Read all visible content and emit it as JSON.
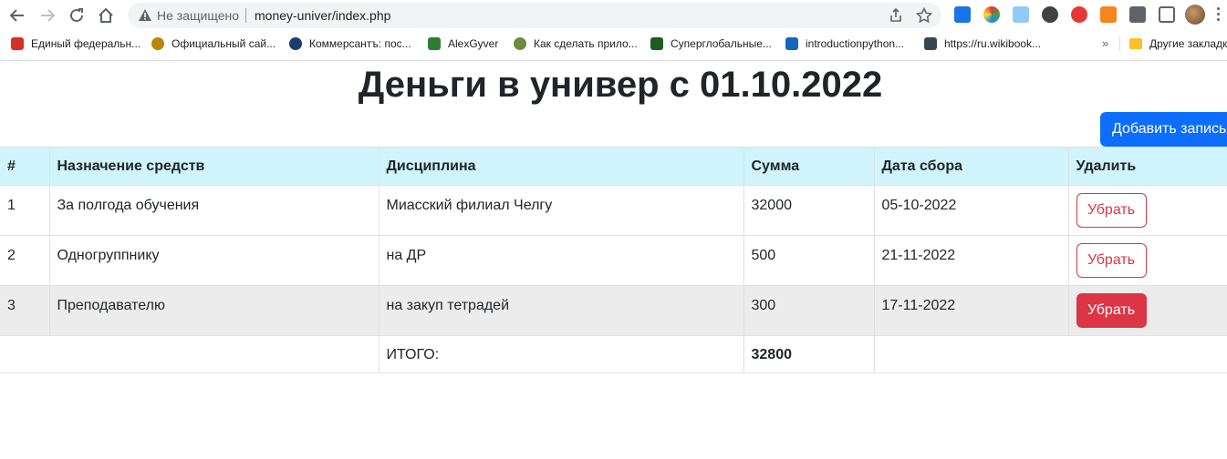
{
  "browser": {
    "security_label": "Не защищено",
    "url": "money-univer/index.php",
    "bookmarks": [
      {
        "label": "Единый федеральн...",
        "color": "#d93025"
      },
      {
        "label": "Официальный сай...",
        "color": "#b8860b"
      },
      {
        "label": "Коммерсантъ: пос...",
        "color": "#1a3d6d"
      },
      {
        "label": "AlexGyver",
        "color": "#2e7d32"
      },
      {
        "label": "Как сделать прило...",
        "color": "#6d8b3a"
      },
      {
        "label": "Суперглобальные...",
        "color": "#1b5e20"
      },
      {
        "label": "introductionpython...",
        "color": "#1565c0"
      },
      {
        "label": "https://ru.wikibook...",
        "color": "#37474f"
      }
    ],
    "more_bookmarks": "»",
    "other_bookmarks": "Другие закладки"
  },
  "page": {
    "title": "Деньги в универ с 01.10.2022",
    "add_button": "Добавить запись"
  },
  "table": {
    "headers": [
      "#",
      "Назначение средств",
      "Дисциплина",
      "Сумма",
      "Дата сбора",
      "Удалить"
    ],
    "rows": [
      {
        "num": "1",
        "purpose": "За полгода обучения",
        "discipline": "Миасский филиал Челгу",
        "sum": "32000",
        "date": "05-10-2022",
        "action": "Убрать"
      },
      {
        "num": "2",
        "purpose": "Одногруппнику",
        "discipline": "на ДР",
        "sum": "500",
        "date": "21-11-2022",
        "action": "Убрать"
      },
      {
        "num": "3",
        "purpose": "Преподавателю",
        "discipline": "на закуп тетрадей",
        "sum": "300",
        "date": "17-11-2022",
        "action": "Убрать"
      }
    ],
    "total_label": "ИТОГО:",
    "total_value": "32800"
  },
  "colors": {
    "primary": "#0d6efd",
    "danger": "#dc3545",
    "header_bg": "#cff4fc"
  }
}
